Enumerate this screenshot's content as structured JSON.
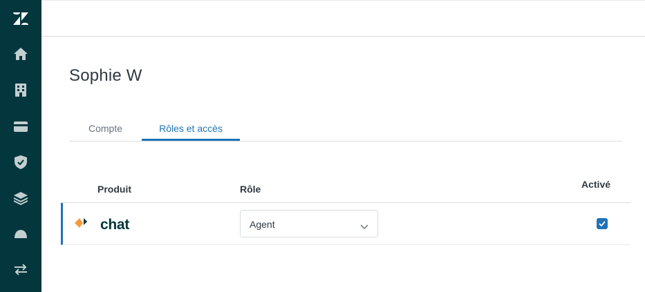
{
  "sidebar": {
    "logo_icon": "zendesk-logo",
    "items": [
      {
        "icon": "home-icon"
      },
      {
        "icon": "building-icon"
      },
      {
        "icon": "credit-card-icon"
      },
      {
        "icon": "shield-check-icon"
      },
      {
        "icon": "layers-icon"
      },
      {
        "icon": "dome-icon"
      },
      {
        "icon": "arrows-exchange-icon"
      }
    ],
    "background": "#03363d"
  },
  "page": {
    "title": "Sophie W"
  },
  "tabs": [
    {
      "label": "Compte",
      "active": false
    },
    {
      "label": "Rôles et accès",
      "active": true
    }
  ],
  "table": {
    "headers": {
      "product": "Produit",
      "role": "Rôle",
      "active": "Activé"
    },
    "rows": [
      {
        "product_name": "chat",
        "product_icon": "chat-logo-icon",
        "role": "Agent",
        "active": true
      }
    ]
  },
  "colors": {
    "accent": "#1f73b7",
    "sidebar": "#03363d",
    "chat_orange": "#f79a3e",
    "chat_dark": "#03363d"
  }
}
